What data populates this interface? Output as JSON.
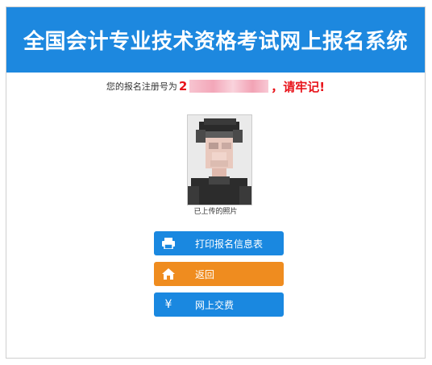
{
  "header": {
    "title": "全国会计专业技术资格考试网上报名系统"
  },
  "registration": {
    "prefix": "您的报名注册号为",
    "number_visible": "2",
    "suffix": "，请牢记!"
  },
  "photo": {
    "caption": "已上传的照片"
  },
  "actions": {
    "print_label": "打印报名信息表",
    "back_label": "返回",
    "pay_label": "网上交费",
    "pay_icon_glyph": "¥"
  },
  "colors": {
    "header_bg": "#1d88df",
    "primary_button": "#1a88e0",
    "back_button": "#ef8c1f",
    "highlight_red": "#e8141b"
  },
  "icons": {
    "print": "printer-icon",
    "back": "home-icon",
    "pay": "yen-icon"
  }
}
